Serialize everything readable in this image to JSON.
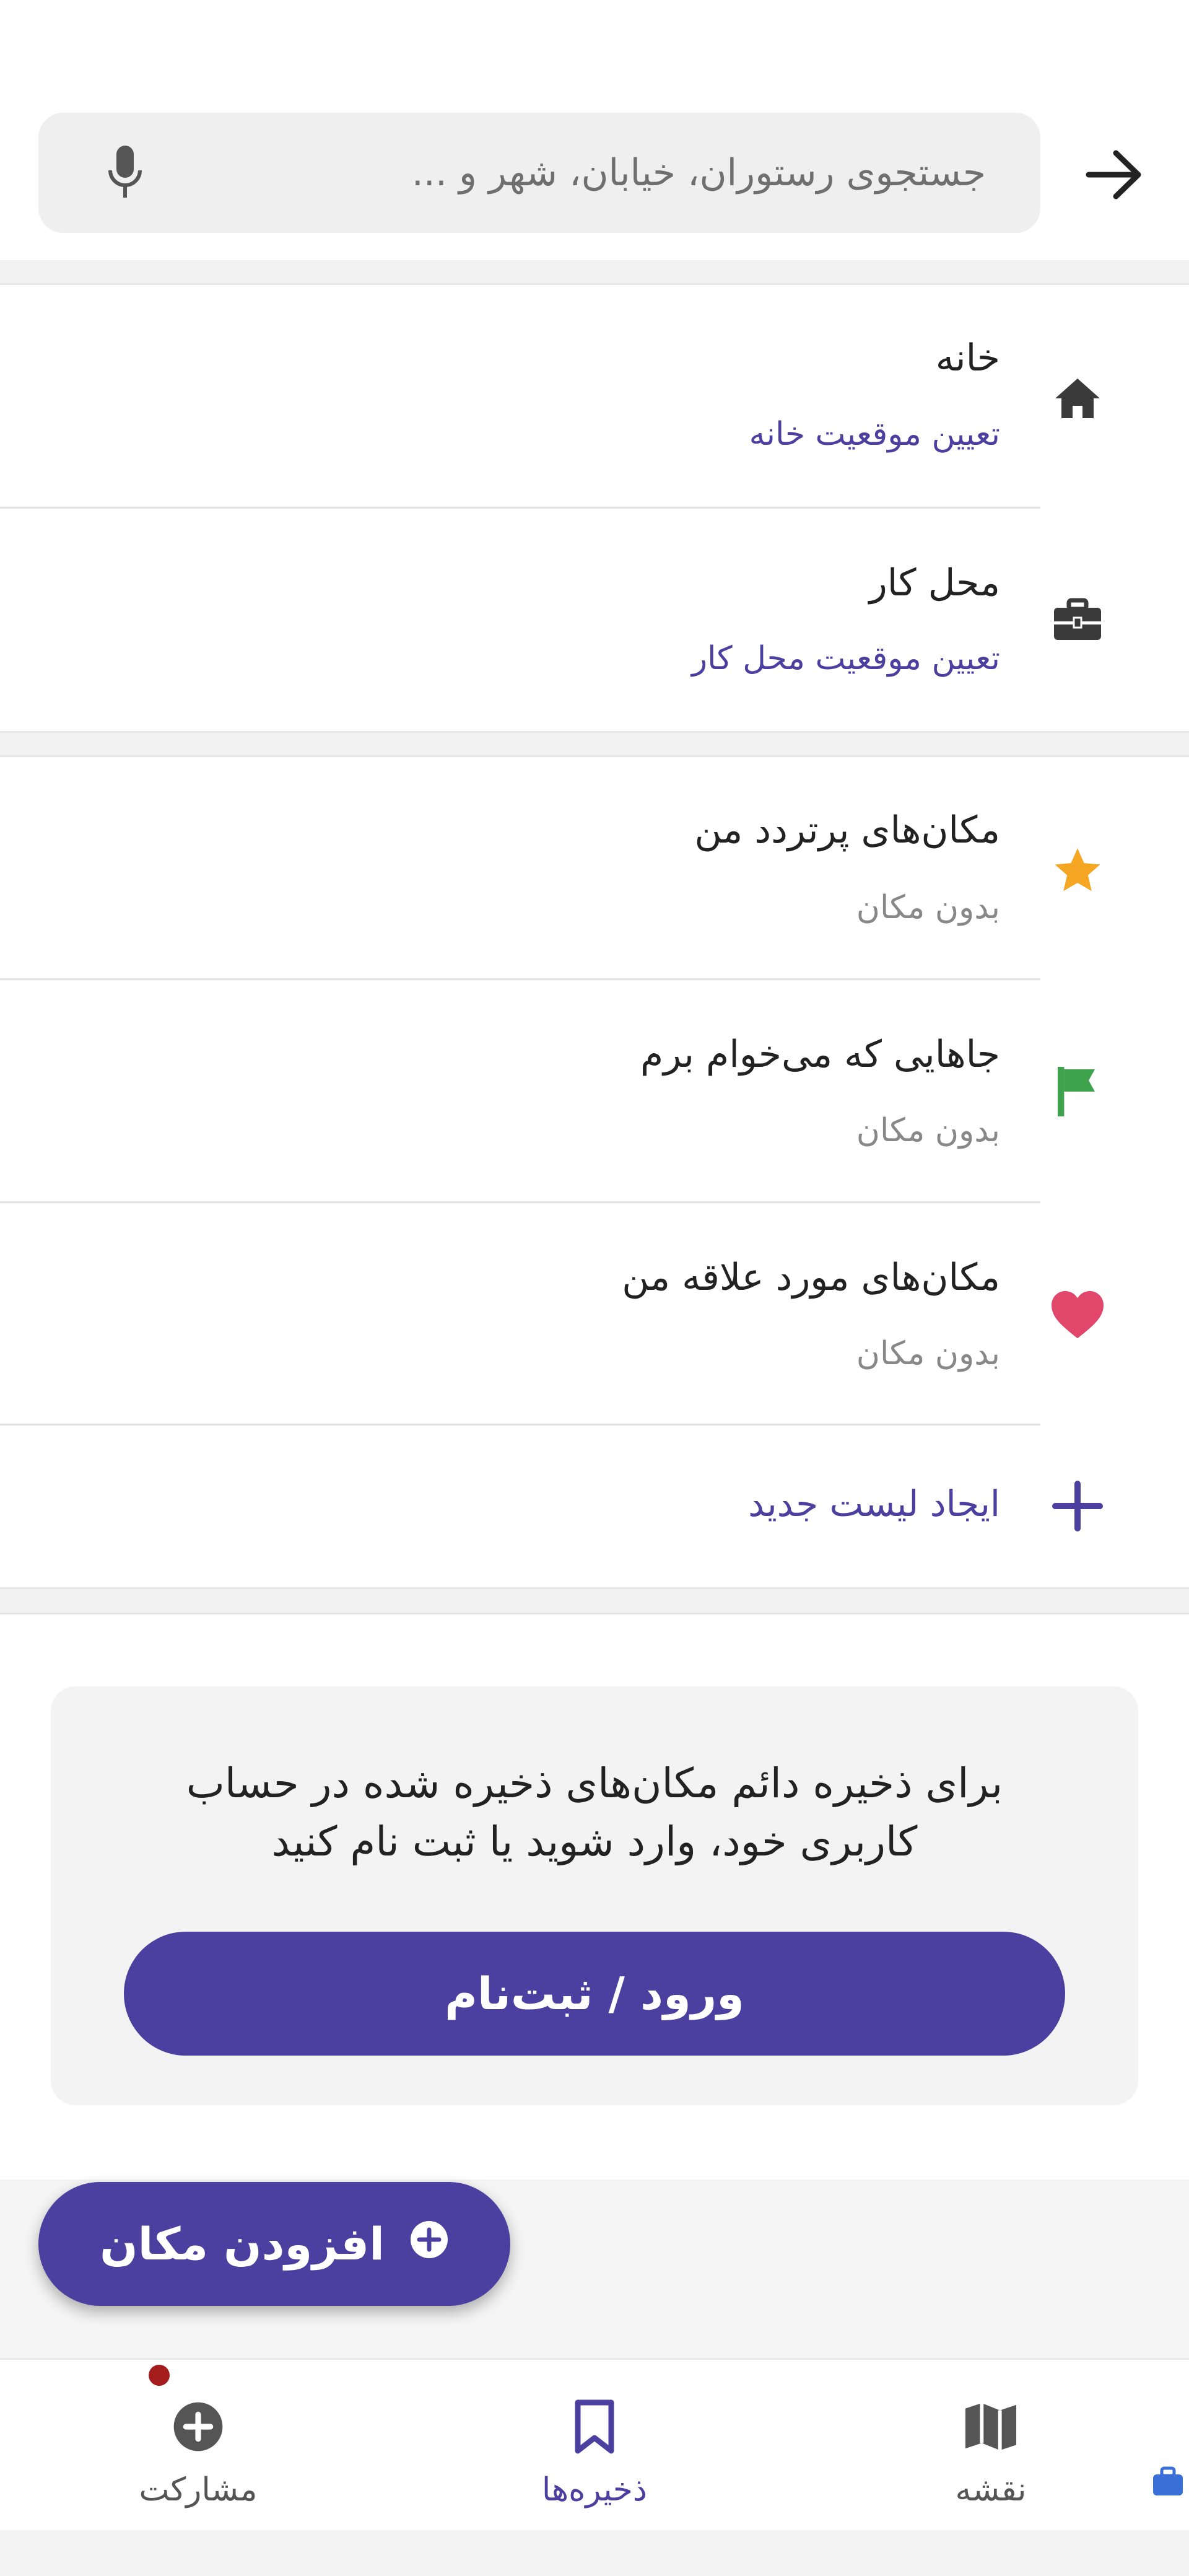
{
  "search": {
    "placeholder": "جستجوی رستوران، خیابان، شهر و ..."
  },
  "shortcuts": [
    {
      "title": "خانه",
      "subtitle": "تعیین موقعیت خانه",
      "icon": "home-icon"
    },
    {
      "title": "محل کار",
      "subtitle": "تعیین موقعیت محل کار",
      "icon": "briefcase-icon"
    }
  ],
  "lists": [
    {
      "title": "مکان‌های پرتردد من",
      "subtitle": "بدون مکان",
      "icon": "star-icon",
      "icon_color": "#f5a623"
    },
    {
      "title": "جاهایی که می‌خوام برم",
      "subtitle": "بدون مکان",
      "icon": "flag-icon",
      "icon_color": "#3fa34d"
    },
    {
      "title": "مکان‌های مورد علاقه من",
      "subtitle": "بدون مکان",
      "icon": "heart-icon",
      "icon_color": "#e0476a"
    }
  ],
  "create_list": {
    "label": "ایجاد لیست جدید",
    "icon": "plus-icon"
  },
  "login_card": {
    "message": "برای ذخیره دائم مکان‌های ذخیره شده در حساب کاربری خود، وارد شوید یا ثبت نام کنید",
    "button_label": "ورود / ثبت‌نام"
  },
  "fab": {
    "label": "افزودن مکان",
    "icon": "plus-circle-icon"
  },
  "bottom_nav": [
    {
      "label": "نقشه",
      "icon": "map-icon",
      "active": false
    },
    {
      "label": "ذخیره‌ها",
      "icon": "bookmark-icon",
      "active": true
    },
    {
      "label": "مشارکت",
      "icon": "plus-circle-icon",
      "active": false,
      "has_notification": true
    }
  ],
  "colors": {
    "accent": "#4b3fa0",
    "text": "#222222",
    "muted": "#888888",
    "notification": "#a51c1c"
  }
}
